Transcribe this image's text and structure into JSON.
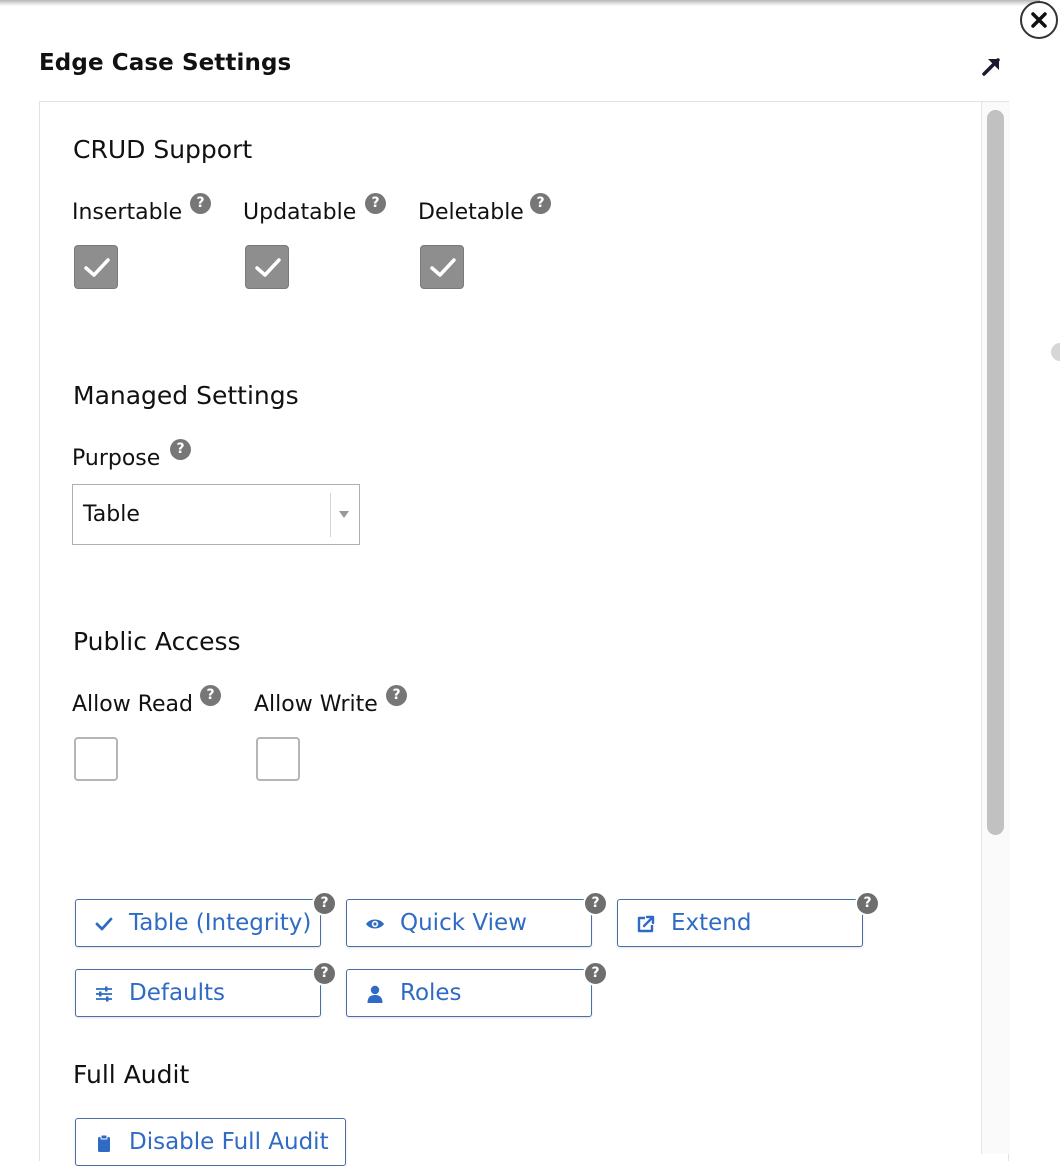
{
  "dialog": {
    "title": "Edge Case Settings",
    "close_icon": "close-icon",
    "expand_icon": "expand-arrow-icon"
  },
  "crud": {
    "title": "CRUD Support",
    "fields": [
      {
        "label": "Insertable",
        "checked": true
      },
      {
        "label": "Updatable",
        "checked": true
      },
      {
        "label": "Deletable",
        "checked": true
      }
    ]
  },
  "managed": {
    "title": "Managed Settings",
    "purpose_label": "Purpose",
    "purpose_value": "Table"
  },
  "public_access": {
    "title": "Public Access",
    "fields": [
      {
        "label": "Allow Read",
        "checked": false
      },
      {
        "label": "Allow Write",
        "checked": false
      }
    ]
  },
  "help_glyph": "?",
  "actions": [
    {
      "label": "Table (Integrity)",
      "icon": "check-icon"
    },
    {
      "label": "Quick View",
      "icon": "eye-icon"
    },
    {
      "label": "Extend",
      "icon": "external-link-icon"
    },
    {
      "label": "Defaults",
      "icon": "sliders-icon"
    },
    {
      "label": "Roles",
      "icon": "user-icon"
    }
  ],
  "full_audit": {
    "title": "Full Audit",
    "button_label": "Disable Full Audit",
    "button_icon": "clipboard-icon"
  },
  "colors": {
    "link_blue": "#2f6bc4",
    "button_border": "#4a6fa8",
    "checked_gray": "#8e8e8e",
    "help_gray": "#777777"
  }
}
